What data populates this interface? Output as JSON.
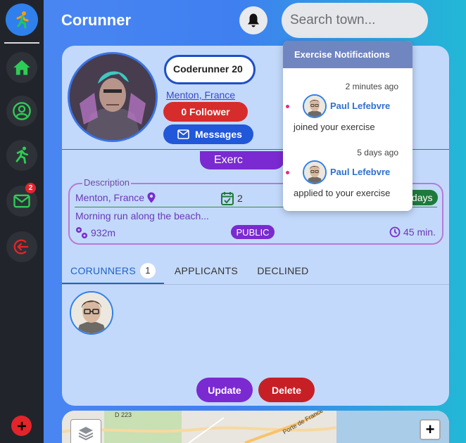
{
  "app": {
    "title": "Corunner"
  },
  "search": {
    "placeholder": "Search town..."
  },
  "sidebar": {
    "items": [
      {
        "icon": "home-icon"
      },
      {
        "icon": "profile-icon"
      },
      {
        "icon": "running-icon"
      },
      {
        "icon": "mail-icon",
        "badge": "2"
      },
      {
        "icon": "logout-icon"
      }
    ],
    "add_icon": "add-icon"
  },
  "profile": {
    "name": "Coderunner 20",
    "location": "Menton, France",
    "follower_label": "0 Follower",
    "messages_label": "Messages"
  },
  "exercise": {
    "pill_label": "Exerc",
    "description_legend": "Description",
    "location": "Menton, France",
    "date": "2",
    "countdown": "in 2 days",
    "description": "Morning run along the beach...",
    "distance": "932m",
    "visibility": "PUBLIC",
    "duration": "45 min."
  },
  "tabs": [
    {
      "label": "CORUNNERS",
      "count": "1",
      "active": true
    },
    {
      "label": "APPLICANTS"
    },
    {
      "label": "DECLINED"
    }
  ],
  "actions": {
    "update_label": "Update",
    "delete_label": "Delete"
  },
  "map": {
    "roads": [
      "D 223",
      "Porte de France"
    ],
    "zoom_in": "+"
  },
  "notifications": {
    "title": "Exercise Notifications",
    "items": [
      {
        "time": "2 minutes ago",
        "name": "Paul Lefebvre",
        "text": "joined your exercise"
      },
      {
        "time": "5 days ago",
        "name": "Paul Lefebvre",
        "text": "applied to your exercise"
      }
    ]
  },
  "colors": {
    "accent_blue": "#2f80ed",
    "purple": "#7a2ad0",
    "red": "#d72c2c",
    "green": "#1e7a3c",
    "card_bg": "#c3d9fb"
  }
}
